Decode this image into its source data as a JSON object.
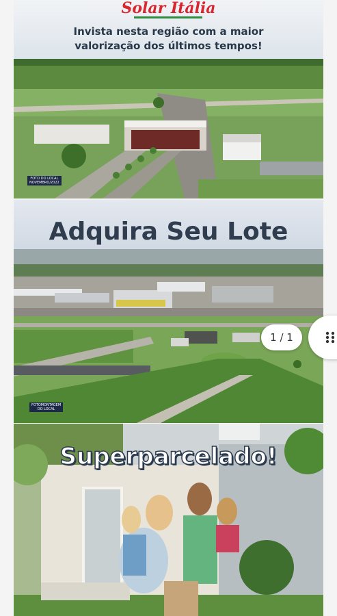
{
  "viewer": {
    "page_indicator": "1 / 1",
    "thumbnails_icon": "grid-dots-icon"
  },
  "slides": [
    {
      "brand": "Solar Itália",
      "tagline_line1": "Invista nesta região com a maior",
      "tagline_line2": "valorização dos últimos tempos!",
      "photo_caption_line1": "FOTO DO LOCAL",
      "photo_caption_line2": "NOVEMBRO/2022"
    },
    {
      "heading": "Adquira Seu Lote",
      "photo_caption_line1": "FOTOMONTAGEM",
      "photo_caption_line2": "DO LOCAL"
    },
    {
      "heading": "Superparcelado!"
    }
  ],
  "colors": {
    "brand_red": "#d8262e",
    "brand_green": "#2d8a3e",
    "heading_navy": "#2f3d4f"
  }
}
